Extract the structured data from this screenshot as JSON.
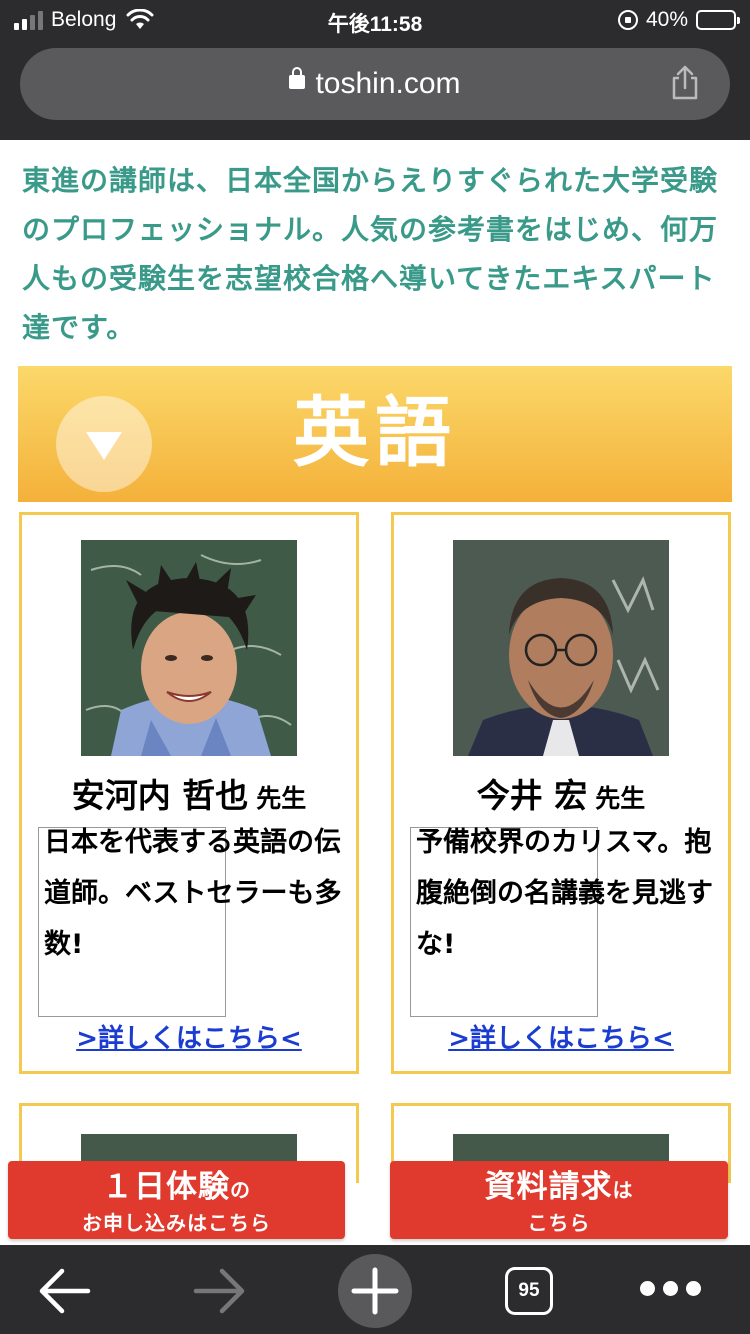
{
  "status_bar": {
    "carrier": "Belong",
    "time": "午後11:58",
    "battery": "40%",
    "battery_level": 0.4
  },
  "browser": {
    "url": "toshin.com",
    "tab_count": "95"
  },
  "intro_text": "東進の講師は、日本全国からえりすぐられた大学受験のプロフェッショナル。人気の参考書をはじめ、何万人もの受験生を志望校合格へ導いてきたエキスパート達です。",
  "subject": {
    "title": "英語"
  },
  "teachers": [
    {
      "name": "安河内 哲也",
      "suffix": "先生",
      "description": "日本を代表する英語の伝道師。ベストセラーも多数!",
      "link": ">詳しくはこちら<"
    },
    {
      "name": "今井 宏",
      "suffix": "先生",
      "description": "予備校界のカリスマ。抱腹絶倒の名講義を見逃すな!",
      "link": ">詳しくはこちら<"
    }
  ],
  "cta": {
    "trial_main": "１日体験",
    "trial_particle": "の",
    "trial_sub": "お申し込みはこちら",
    "docs_main": "資料請求",
    "docs_particle": "は",
    "docs_sub": "こちら"
  },
  "colors": {
    "intro_text": "#3a9a8a",
    "banner_top": "#fbd86a",
    "banner_bottom": "#f4b13a",
    "card_border": "#f4c94f",
    "cta_red": "#e03a2e",
    "link_blue": "#1a3cd0",
    "browser_chrome": "#2c2c2e"
  },
  "icons": {
    "signal": "signal-bars-icon",
    "wifi": "wifi-icon",
    "rotation_lock": "rotation-lock-icon",
    "battery": "battery-icon",
    "lock": "lock-icon",
    "share": "share-icon",
    "back": "back-arrow-icon",
    "forward": "forward-arrow-icon",
    "new_tab": "plus-icon",
    "tabs": "tabs-icon",
    "menu": "more-dots-icon"
  }
}
